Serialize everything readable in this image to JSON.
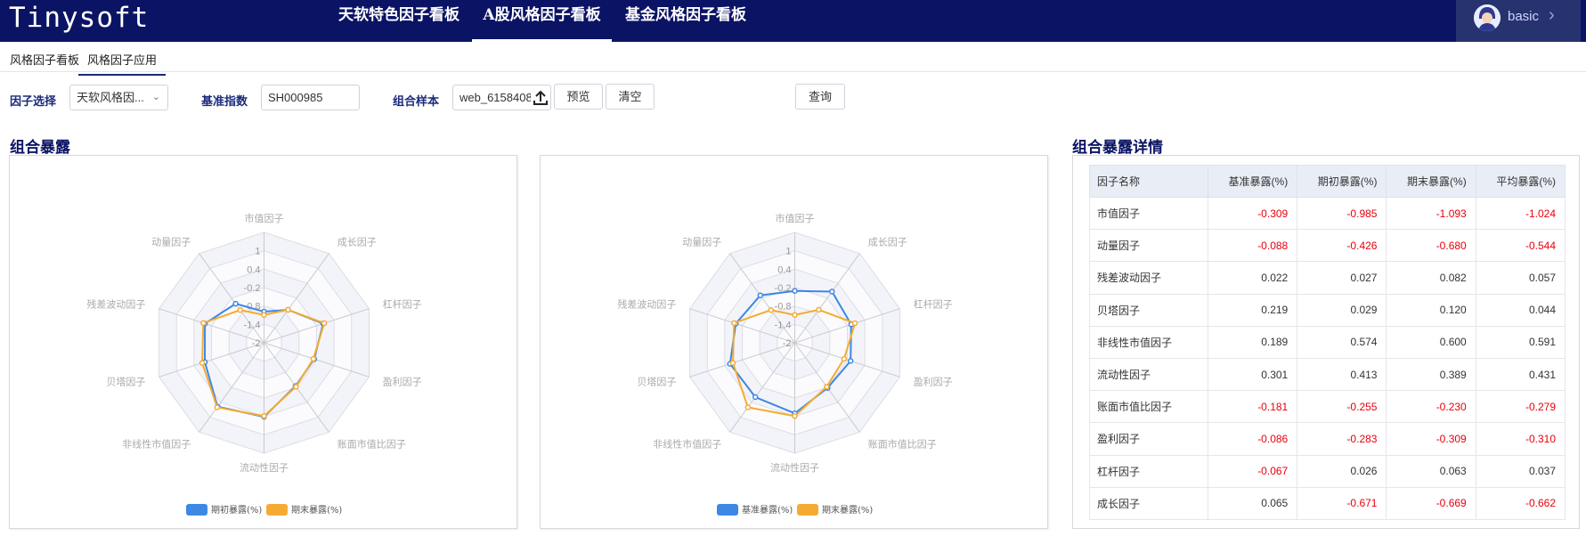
{
  "app": {
    "logo": "Tinysoft",
    "user": "basic"
  },
  "nav": [
    "天软特色因子看板",
    "A股风格因子看板",
    "基金风格因子看板"
  ],
  "subtabs": [
    "风格因子看板",
    "风格因子应用"
  ],
  "filters": {
    "factor_label": "因子选择",
    "factor_value": "天软风格因...",
    "index_label": "基准指数",
    "index_value": "SH000985",
    "sample_label": "组合样本",
    "sample_value": "web_6158408",
    "preview": "预览",
    "clear": "清空",
    "query": "查询"
  },
  "sections": {
    "exposure": "组合暴露",
    "detail": "组合暴露详情"
  },
  "colors": {
    "blue": "#3d87e5",
    "orange": "#f5ab32",
    "nav_bg": "#0b1464",
    "negative": "#e8000b"
  },
  "chart_data": [
    {
      "type": "radar",
      "indicators": [
        "市值因子",
        "成长因子",
        "杠杆因子",
        "盈利因子",
        "账面市值比因子",
        "流动性因子",
        "非线性市值因子",
        "贝塔因子",
        "残差波动因子",
        "动量因子"
      ],
      "axis_labels": [
        "1",
        "0.4",
        "-0.2",
        "-0.8",
        "-1.4",
        "-2"
      ],
      "range": [
        -2,
        1.6
      ],
      "series": [
        {
          "name": "期初暴露(%)",
          "color": "#3d87e5",
          "values": [
            -0.985,
            -0.671,
            0.026,
            -0.283,
            -0.255,
            0.413,
            0.574,
            0.029,
            0.027,
            -0.426
          ]
        },
        {
          "name": "期末暴露(%)",
          "color": "#f5ab32",
          "values": [
            -1.093,
            -0.669,
            0.063,
            -0.309,
            -0.23,
            0.389,
            0.6,
            0.12,
            0.082,
            -0.68
          ]
        }
      ]
    },
    {
      "type": "radar",
      "indicators": [
        "市值因子",
        "成长因子",
        "杠杆因子",
        "盈利因子",
        "账面市值比因子",
        "流动性因子",
        "非线性市值因子",
        "贝塔因子",
        "残差波动因子",
        "动量因子"
      ],
      "axis_labels": [
        "1",
        "0.4",
        "-0.2",
        "-0.8",
        "-1.4",
        "-2"
      ],
      "range": [
        -2,
        1.6
      ],
      "series": [
        {
          "name": "基准暴露(%)",
          "color": "#3d87e5",
          "values": [
            -0.309,
            0.065,
            -0.067,
            -0.086,
            -0.181,
            0.301,
            0.189,
            0.219,
            0.022,
            -0.088
          ]
        },
        {
          "name": "期末暴露(%)",
          "color": "#f5ab32",
          "values": [
            -1.093,
            -0.669,
            0.063,
            -0.309,
            -0.23,
            0.389,
            0.6,
            0.12,
            0.082,
            -0.68
          ]
        }
      ]
    }
  ],
  "table": {
    "headers": [
      "因子名称",
      "基准暴露(%)",
      "期初暴露(%)",
      "期末暴露(%)",
      "平均暴露(%)"
    ],
    "rows": [
      [
        "市值因子",
        "-0.309",
        "-0.985",
        "-1.093",
        "-1.024"
      ],
      [
        "动量因子",
        "-0.088",
        "-0.426",
        "-0.680",
        "-0.544"
      ],
      [
        "残差波动因子",
        "0.022",
        "0.027",
        "0.082",
        "0.057"
      ],
      [
        "贝塔因子",
        "0.219",
        "0.029",
        "0.120",
        "0.044"
      ],
      [
        "非线性市值因子",
        "0.189",
        "0.574",
        "0.600",
        "0.591"
      ],
      [
        "流动性因子",
        "0.301",
        "0.413",
        "0.389",
        "0.431"
      ],
      [
        "账面市值比因子",
        "-0.181",
        "-0.255",
        "-0.230",
        "-0.279"
      ],
      [
        "盈利因子",
        "-0.086",
        "-0.283",
        "-0.309",
        "-0.310"
      ],
      [
        "杠杆因子",
        "-0.067",
        "0.026",
        "0.063",
        "0.037"
      ],
      [
        "成长因子",
        "0.065",
        "-0.671",
        "-0.669",
        "-0.662"
      ]
    ]
  }
}
